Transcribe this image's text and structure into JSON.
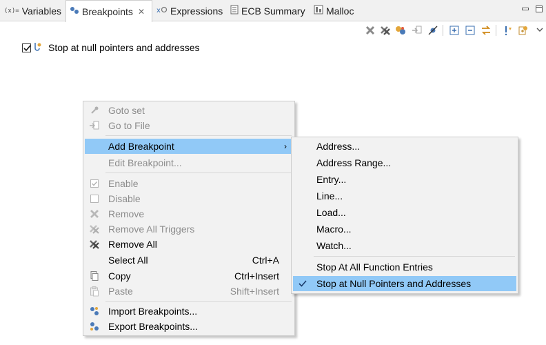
{
  "tabs": [
    {
      "label": "Variables",
      "icon": "variables-icon",
      "active": false
    },
    {
      "label": "Breakpoints",
      "icon": "breakpoints-icon",
      "active": true
    },
    {
      "label": "Expressions",
      "icon": "expressions-icon",
      "active": false
    },
    {
      "label": "ECB Summary",
      "icon": "ecb-summary-icon",
      "active": false
    },
    {
      "label": "Malloc",
      "icon": "malloc-icon",
      "active": false
    }
  ],
  "breakpoint": {
    "checked": true,
    "label": "Stop at null pointers and addresses"
  },
  "context_menu": {
    "items": [
      {
        "label": "Goto set",
        "enabled": false,
        "icon": "goto-icon"
      },
      {
        "label": "Go to File",
        "enabled": false,
        "icon": "go-to-file-icon"
      },
      {
        "label": "Add Breakpoint",
        "enabled": true,
        "highlighted": true,
        "has_submenu": true
      },
      {
        "label": "Edit Breakpoint...",
        "enabled": false
      },
      {
        "label": "Enable",
        "enabled": false,
        "icon": "checkbox-checked-icon"
      },
      {
        "label": "Disable",
        "enabled": false,
        "icon": "checkbox-empty-icon"
      },
      {
        "label": "Remove",
        "enabled": false,
        "icon": "remove-icon"
      },
      {
        "label": "Remove All Triggers",
        "enabled": false,
        "icon": "remove-all-triggers-icon"
      },
      {
        "label": "Remove All",
        "enabled": true,
        "icon": "remove-all-icon"
      },
      {
        "label": "Select All",
        "enabled": true,
        "shortcut": "Ctrl+A"
      },
      {
        "label": "Copy",
        "enabled": true,
        "shortcut": "Ctrl+Insert",
        "icon": "copy-icon"
      },
      {
        "label": "Paste",
        "enabled": false,
        "shortcut": "Shift+Insert",
        "icon": "paste-icon"
      },
      {
        "label": "Import Breakpoints...",
        "enabled": true,
        "icon": "import-breakpoints-icon"
      },
      {
        "label": "Export Breakpoints...",
        "enabled": true,
        "icon": "export-breakpoints-icon"
      }
    ]
  },
  "submenu": {
    "items": [
      {
        "label": "Address..."
      },
      {
        "label": "Address Range..."
      },
      {
        "label": "Entry..."
      },
      {
        "label": "Line..."
      },
      {
        "label": "Load..."
      },
      {
        "label": "Macro..."
      },
      {
        "label": "Watch..."
      },
      {
        "label": "Stop At All Function Entries"
      },
      {
        "label": "Stop at Null Pointers and Addresses",
        "checked": true,
        "highlighted": true
      }
    ]
  },
  "colors": {
    "menu_highlight": "#91c9f7",
    "tab_active_text": "#0a0a0a",
    "disabled_text": "#8c8c8c"
  }
}
